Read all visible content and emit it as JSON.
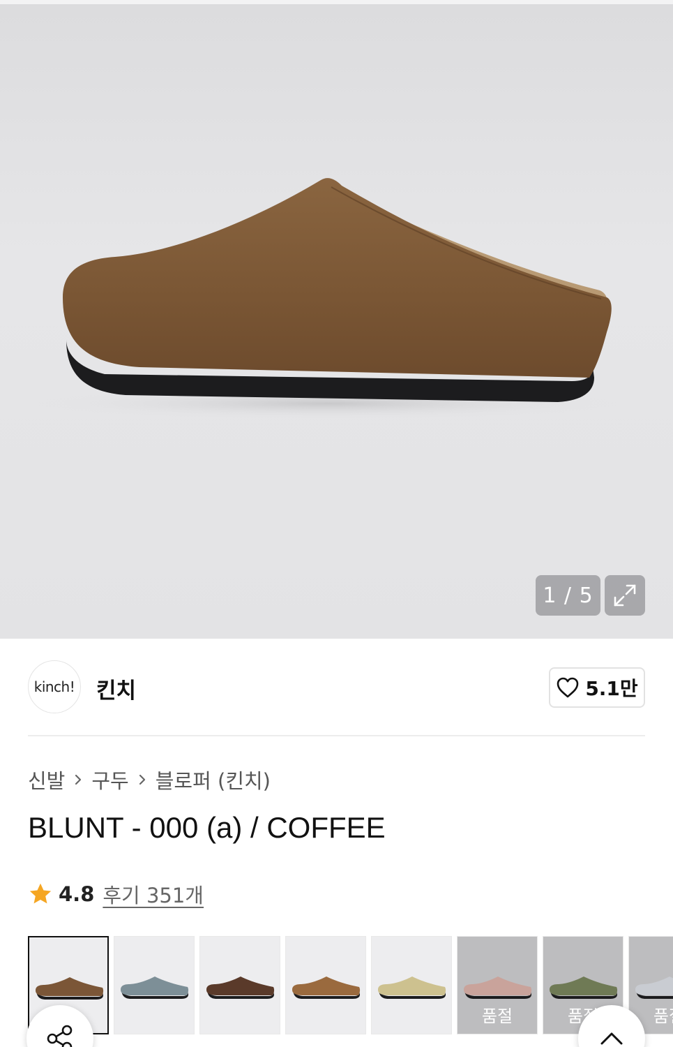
{
  "gallery": {
    "counter": "1 / 5",
    "expand_icon": "expand-icon",
    "bg": "#e3e3e5",
    "product_color": "#7d5a37"
  },
  "brand": {
    "logo_text": "kinch!",
    "name": "킨치",
    "like_icon": "heart-icon",
    "like_count": "5.1만"
  },
  "breadcrumb": {
    "items": [
      "신발",
      "구두",
      "블로퍼 (킨치)"
    ],
    "separator_icon": "chevron-right-icon"
  },
  "product": {
    "title": "BLUNT - 000 (a) / COFFEE"
  },
  "rating": {
    "star_icon": "star-icon",
    "star_color": "#f5a623",
    "score": "4.8",
    "reviews": "후기 351개"
  },
  "colors": [
    {
      "name": "coffee",
      "color": "#7b5637",
      "selected": true,
      "soldout": ""
    },
    {
      "name": "blue-grey",
      "color": "#7d8f97",
      "selected": false,
      "soldout": ""
    },
    {
      "name": "dark-brown",
      "color": "#5a3a2a",
      "selected": false,
      "soldout": ""
    },
    {
      "name": "camel",
      "color": "#9a6a3e",
      "selected": false,
      "soldout": ""
    },
    {
      "name": "sand",
      "color": "#cdc18f",
      "selected": false,
      "soldout": ""
    },
    {
      "name": "pink",
      "color": "#c9a39b",
      "selected": false,
      "soldout": "품절"
    },
    {
      "name": "olive",
      "color": "#6f7a55",
      "selected": false,
      "soldout": "품절"
    },
    {
      "name": "light-grey",
      "color": "#c9ccd2",
      "selected": false,
      "soldout": "품절"
    }
  ],
  "floating": {
    "share_icon": "share-icon",
    "top_icon": "chevron-up-icon"
  }
}
